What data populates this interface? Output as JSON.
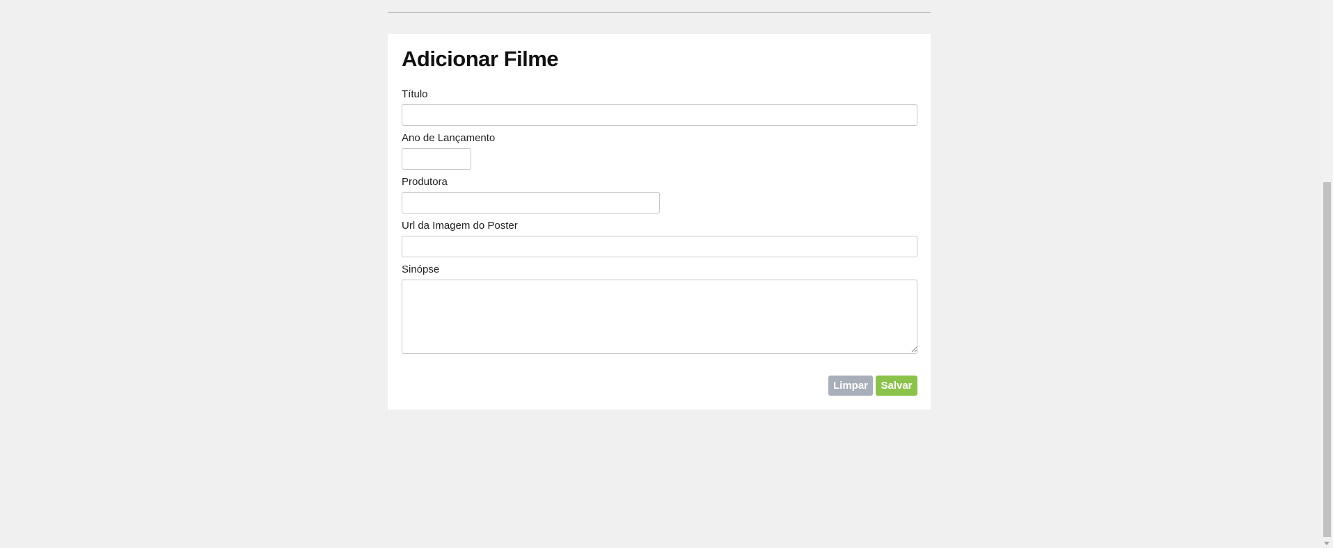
{
  "form": {
    "title": "Adicionar Filme",
    "fields": {
      "titulo": {
        "label": "Título",
        "value": ""
      },
      "ano": {
        "label": "Ano de Lançamento",
        "value": ""
      },
      "produtora": {
        "label": "Produtora",
        "value": ""
      },
      "poster_url": {
        "label": "Url da Imagem do Poster",
        "value": ""
      },
      "sinopse": {
        "label": "Sinópse",
        "value": ""
      }
    },
    "buttons": {
      "clear_label": "Limpar",
      "save_label": "Salvar"
    }
  },
  "colors": {
    "page_background": "#f0f0f0",
    "card_background": "#ffffff",
    "clear_button": "#a8afba",
    "save_button": "#8bc34a",
    "field_border": "#c6c6c6"
  },
  "icons": {
    "resize_handle": "textarea-resize-icon",
    "scroll_down": "scroll-down-arrow-icon"
  }
}
